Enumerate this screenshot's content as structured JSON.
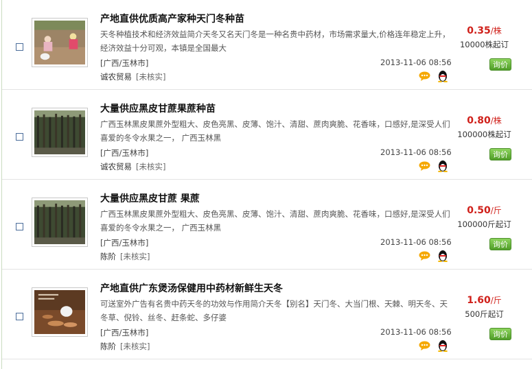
{
  "listings": [
    {
      "title": "产地直供优质高产家种天门冬种苗",
      "description": "天冬种植技术和经济效益简介天冬又名天门冬是一种名贵中药材，市场需求量大,价格连年稳定上升，经济效益十分可观，本镇是全国最大",
      "region": "[广西/玉林市]",
      "date": "2013-11-06 08:56",
      "company": "诚农贸易",
      "verify": "[未核实]",
      "price": "0.35",
      "unit": "/株",
      "moq": "10000株起订",
      "inquiry": "询价",
      "thumb": "people-field-photo"
    },
    {
      "title": "大量供应黑皮甘蔗果蔗种苗",
      "description": "广西玉林黑皮果蔗外型粗大、皮色亮黑、皮薄、饱汁、清甜、蔗肉爽脆、花香味，口感好,是深受人们喜爱的冬令水果之一， 广西玉林黑",
      "region": "[广西/玉林市]",
      "date": "2013-11-06 08:56",
      "company": "诚农贸易",
      "verify": "[未核实]",
      "price": "0.80",
      "unit": "/株",
      "moq": "100000株起订",
      "inquiry": "询价",
      "thumb": "sugarcane-photo"
    },
    {
      "title": "大量供应黑皮甘蔗 果蔗",
      "description": "广西玉林黑皮果蔗外型粗大、皮色亮黑、皮薄、饱汁、清甜、蔗肉爽脆、花香味，口感好,是深受人们喜爱的冬令水果之一， 广西玉林黑",
      "region": "[广西/玉林市]",
      "date": "2013-11-06 08:56",
      "company": "陈阶",
      "verify": "[未核实]",
      "price": "0.50",
      "unit": "/斤",
      "moq": "100000斤起订",
      "inquiry": "询价",
      "thumb": "sugarcane-photo"
    },
    {
      "title": "产地直供广东煲汤保健用中药材新鲜生天冬",
      "description": "可送室外广告有名贵中药天冬的功效与作用简介天冬【别名】天门冬、大当门根、天棘、明天冬、天冬草、倪铃、丝冬、赶条蛇、多仔婆",
      "region": "[广西/玉林市]",
      "date": "2013-11-06 08:56",
      "company": "陈阶",
      "verify": "[未核实]",
      "price": "1.60",
      "unit": "/斤",
      "moq": "500斤起订",
      "inquiry": "询价",
      "thumb": "tuber-harvest-photo"
    }
  ],
  "colors": {
    "price": "#d0201a",
    "button": "#5aab30"
  }
}
